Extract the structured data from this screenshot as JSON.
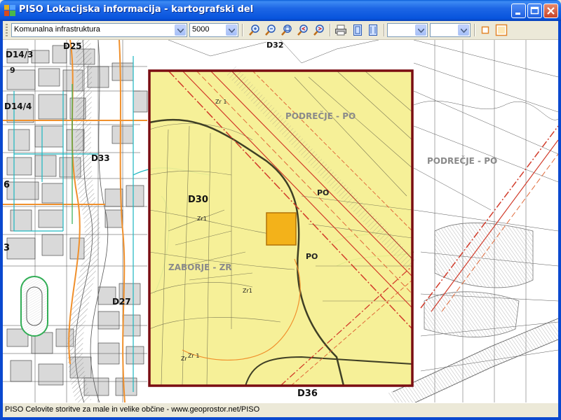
{
  "window": {
    "title": "PISO Lokacijska informacija - kartografski del"
  },
  "toolbar": {
    "layer_select": {
      "value": "Komunalna infrastruktura"
    },
    "scale_select": {
      "value": "5000"
    },
    "combo3": {
      "value": ""
    },
    "combo4": {
      "value": ""
    },
    "tool_icons": [
      "zoom-in-icon",
      "zoom-out-icon",
      "zoom-extent-icon",
      "zoom-previous-icon",
      "zoom-next-icon",
      "print-icon",
      "page-portrait-icon",
      "page-landscape-icon",
      "small-frame-icon",
      "large-frame-icon"
    ]
  },
  "map": {
    "zone_labels": [
      "PODREČJE - PO",
      "PODREČJE - PO",
      "ZABORJE - ZR"
    ],
    "district_labels": [
      "D14/3",
      "D25",
      "D14/4",
      "D33",
      "D30",
      "D27",
      "D36",
      "D32",
      "6",
      "3",
      "9"
    ],
    "parcel_labels": [
      "Zr1",
      "Zr1",
      "Zr 1",
      "Zr 1",
      "PO",
      "PO",
      "Zr"
    ],
    "colors": {
      "selection_fill": "#f5ef8f",
      "selection_border": "#7a0d12",
      "selected_parcel": "#f3b21a",
      "road_orange": "#f0902c",
      "pipeline_red": "#d13b2a",
      "cyan_lines": "#1cb6c0",
      "green_lines": "#2fae54"
    }
  },
  "status": {
    "text": "PISO Celovite storitve za male in velike občine - www.geoprostor.net/PISO"
  }
}
